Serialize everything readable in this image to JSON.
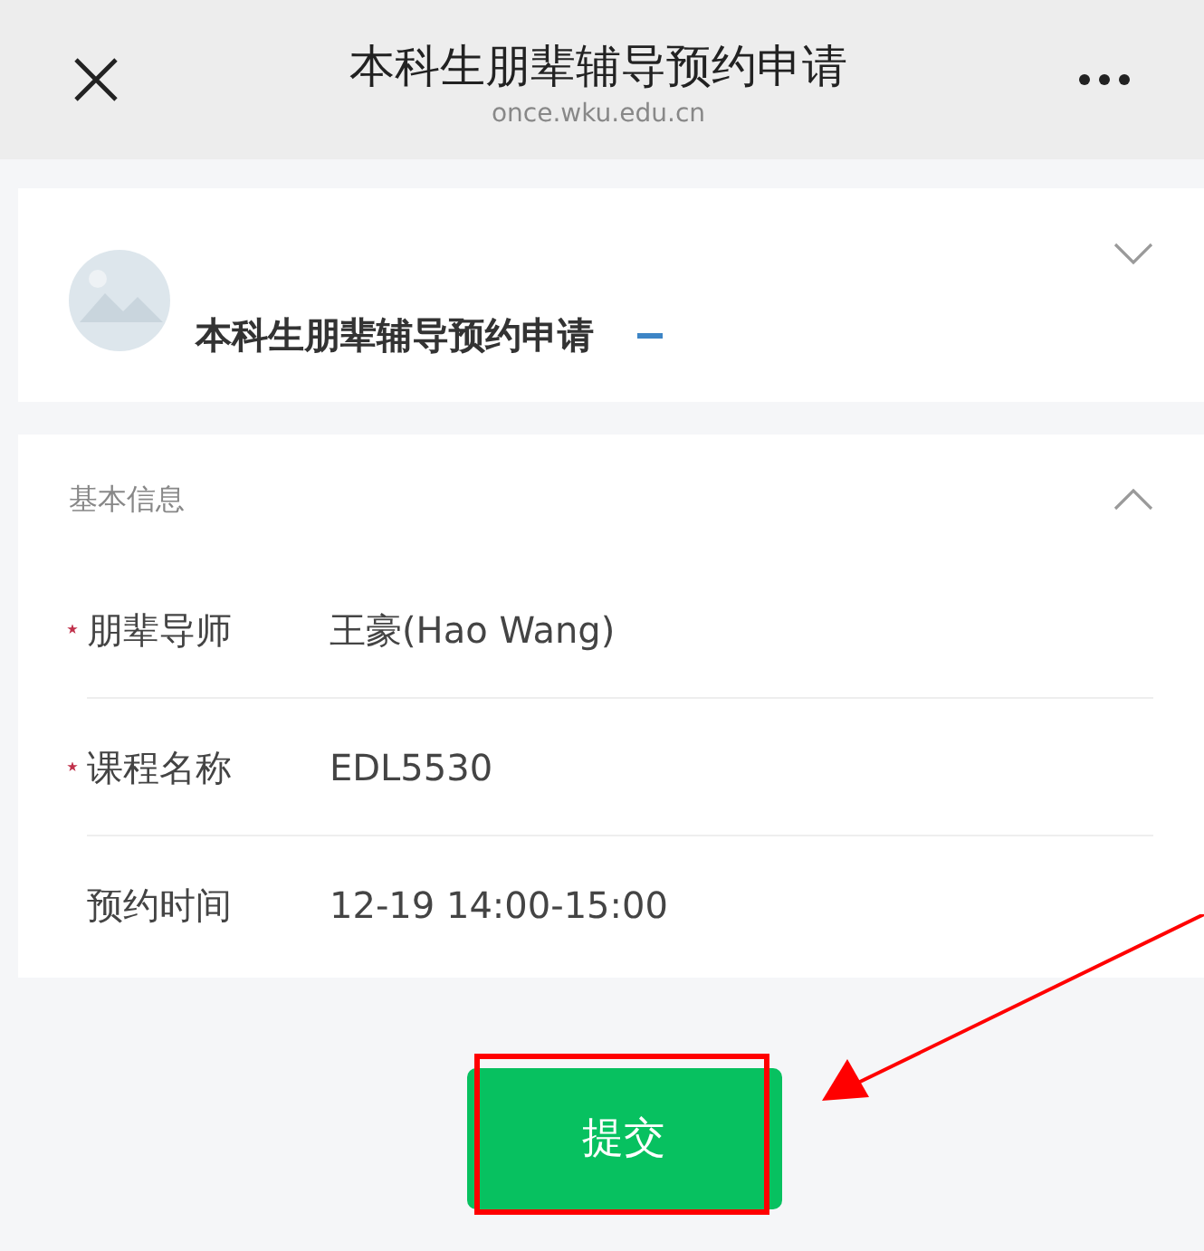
{
  "nav_bar": {
    "title": "本科生朋辈辅导预约申请",
    "subtitle": "once.wku.edu.cn"
  },
  "form_header": {
    "title": "本科生朋辈辅导预约申请",
    "expanded": false
  },
  "section": {
    "title": "基本信息",
    "expanded": true,
    "fields": [
      {
        "label": "朋辈导师",
        "value": "王豪(Hao Wang)",
        "required": true
      },
      {
        "label": "课程名称",
        "value": "EDL5530",
        "required": true
      },
      {
        "label": "预约时间",
        "value": "12-19 14:00-15:00",
        "required": false
      }
    ]
  },
  "submit_button": {
    "label": "提交"
  }
}
